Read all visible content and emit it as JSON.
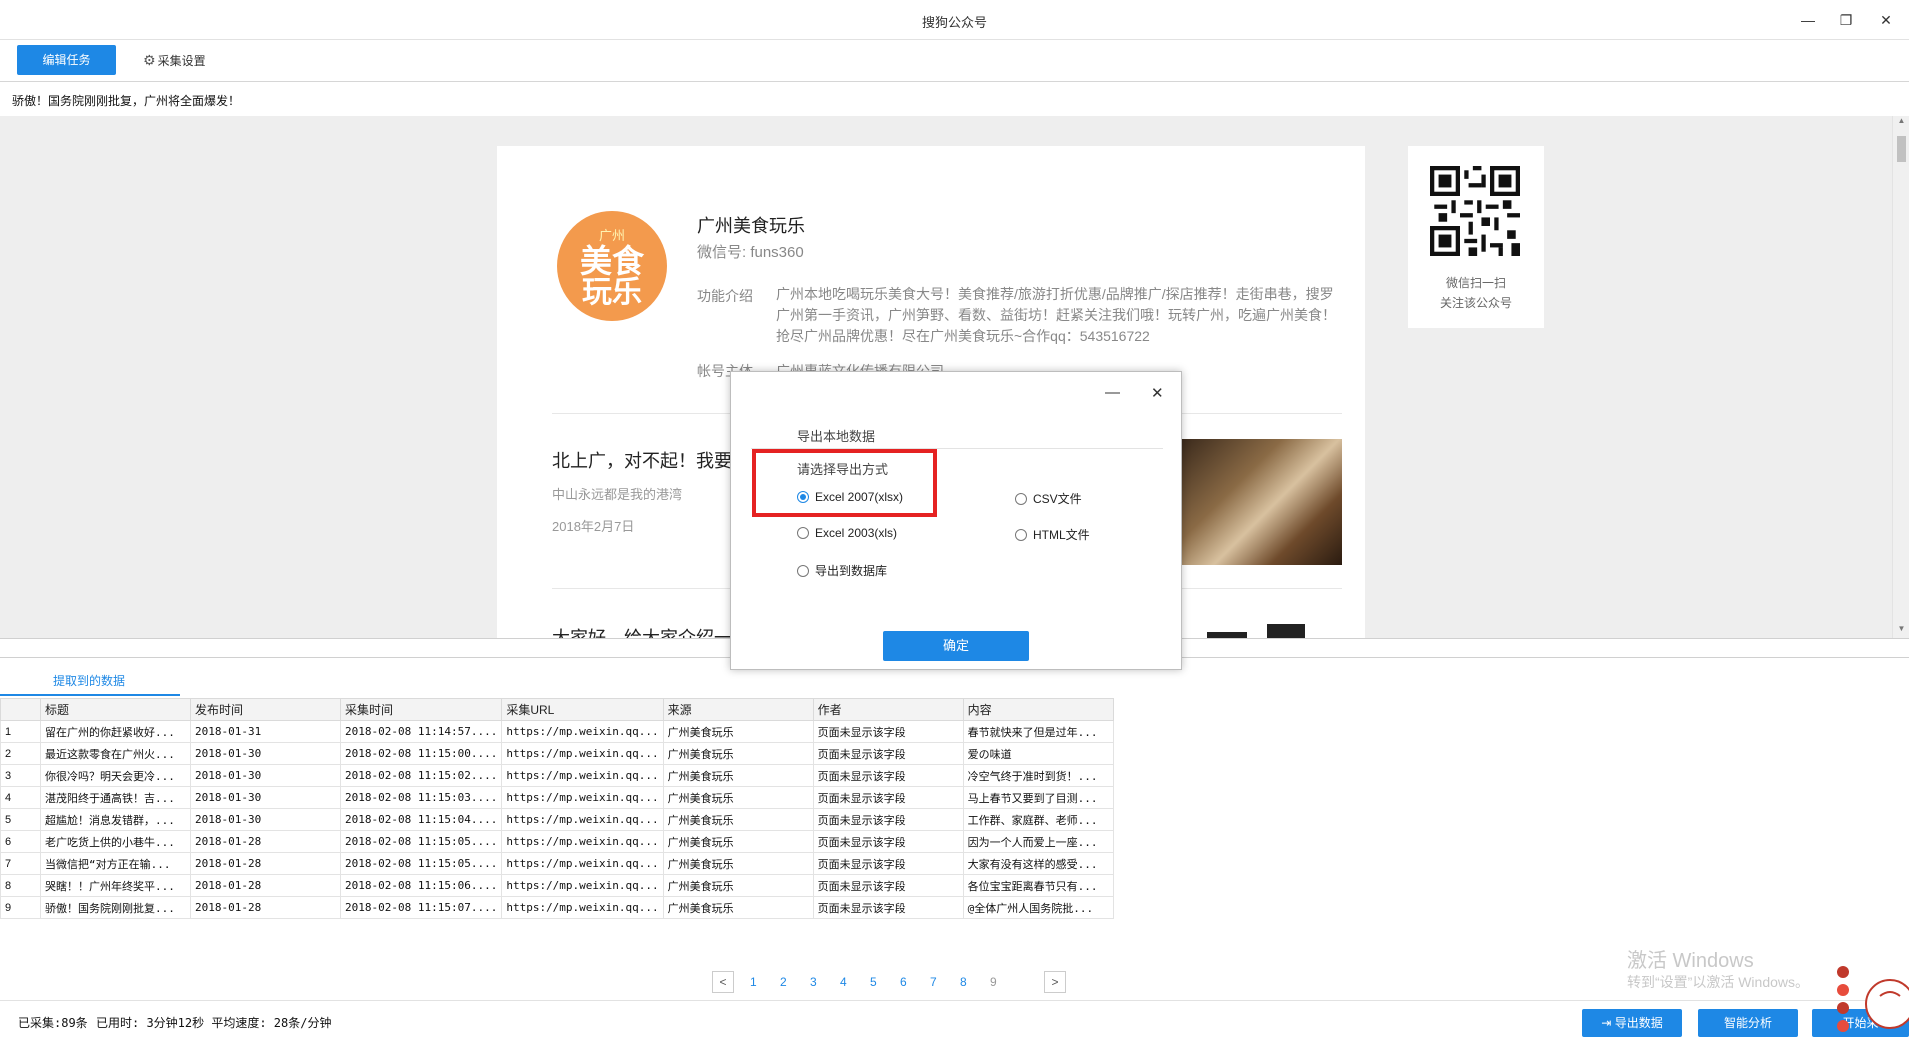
{
  "window": {
    "title": "搜狗公众号"
  },
  "toolbar": {
    "edit_task": "编辑任务",
    "collect_settings": "采集设置"
  },
  "headline": "骄傲！国务院刚刚批复，广州将全面爆发！",
  "account": {
    "logo_small": "广州",
    "logo_line1": "美食",
    "logo_line2": "玩乐",
    "name": "广州美食玩乐",
    "wechat_id": "微信号: funs360",
    "func_label": "功能介绍",
    "func_text": "广州本地吃喝玩乐美食大号！美食推荐/旅游打折优惠/品牌推广/探店推荐！走街串巷，搜罗广州第一手资讯，广州笋野、看数、益街坊！赶紧关注我们哦！玩转广州，吃遍广州美食！抢尽广州品牌优惠！尽在广州美食玩乐~合作qq：543516722",
    "entity_label": "帐号主体",
    "entity_text": "广州惠蓝文化传播有限公司"
  },
  "qr": {
    "caption1": "微信扫一扫",
    "caption2": "关注该公众号"
  },
  "article1": {
    "title": "北上广，对不起！我要",
    "subtitle": "中山永远都是我的港湾",
    "date": "2018年2月7日"
  },
  "article2": {
    "title": "大家好，给大家介绍一"
  },
  "bottom_tab": "提取到的数据",
  "grid": {
    "headers": [
      "",
      "标题",
      "发布时间",
      "采集时间",
      "采集URL",
      "来源",
      "作者",
      "内容"
    ],
    "rows": [
      [
        "1",
        "留在广州的你赶紧收好...",
        "2018-01-31",
        "2018-02-08 11:14:57....",
        "https://mp.weixin.qq...",
        "广州美食玩乐",
        "页面未显示该字段",
        "春节就快来了但是过年..."
      ],
      [
        "2",
        "最近这款零食在广州火...",
        "2018-01-30",
        "2018-02-08 11:15:00....",
        "https://mp.weixin.qq...",
        "广州美食玩乐",
        "页面未显示该字段",
        "爱の味道"
      ],
      [
        "3",
        "你很冷吗？明天会更冷...",
        "2018-01-30",
        "2018-02-08 11:15:02....",
        "https://mp.weixin.qq...",
        "广州美食玩乐",
        "页面未显示该字段",
        "冷空气终于准时到货！..."
      ],
      [
        "4",
        "湛茂阳终于通高铁！吉...",
        "2018-01-30",
        "2018-02-08 11:15:03....",
        "https://mp.weixin.qq...",
        "广州美食玩乐",
        "页面未显示该字段",
        "马上春节又要到了目测..."
      ],
      [
        "5",
        "超尴尬！消息发错群，...",
        "2018-01-30",
        "2018-02-08 11:15:04....",
        "https://mp.weixin.qq...",
        "广州美食玩乐",
        "页面未显示该字段",
        "工作群、家庭群、老师..."
      ],
      [
        "6",
        "老广吃货上供的小巷牛...",
        "2018-01-28",
        "2018-02-08 11:15:05....",
        "https://mp.weixin.qq...",
        "广州美食玩乐",
        "页面未显示该字段",
        "因为一个人而爱上一座..."
      ],
      [
        "7",
        "当微信把“对方正在输...",
        "2018-01-28",
        "2018-02-08 11:15:05....",
        "https://mp.weixin.qq...",
        "广州美食玩乐",
        "页面未显示该字段",
        "大家有没有这样的感受..."
      ],
      [
        "8",
        "哭瞎！！广州年终奖平...",
        "2018-01-28",
        "2018-02-08 11:15:06....",
        "https://mp.weixin.qq...",
        "广州美食玩乐",
        "页面未显示该字段",
        "各位宝宝距离春节只有..."
      ],
      [
        "9",
        "骄傲！国务院刚刚批复...",
        "2018-01-28",
        "2018-02-08 11:15:07....",
        "https://mp.weixin.qq...",
        "广州美食玩乐",
        "页面未显示该字段",
        "@全体广州人国务院批..."
      ]
    ]
  },
  "pager": {
    "prev": "<",
    "next": ">",
    "pages": [
      "1",
      "2",
      "3",
      "4",
      "5",
      "6",
      "7",
      "8",
      "9"
    ]
  },
  "watermark": {
    "line1": "激活 Windows",
    "line2": "转到“设置”以激活 Windows。"
  },
  "status": {
    "collected": "已采集:89条",
    "time": "已用时: 3分钟12秒 平均速度: 28条/分钟"
  },
  "buttons": {
    "export": "导出数据",
    "analyze": "智能分析",
    "more": "开始采"
  },
  "modal": {
    "heading": "导出本地数据",
    "choose": "请选择导出方式",
    "opt_xlsx": "Excel 2007(xlsx)",
    "opt_csv": "CSV文件",
    "opt_xls": "Excel 2003(xls)",
    "opt_html": "HTML文件",
    "opt_db": "导出到数据库",
    "confirm": "确定"
  },
  "colors": {
    "accent": "#1e88e5",
    "highlight": "#e52222"
  }
}
